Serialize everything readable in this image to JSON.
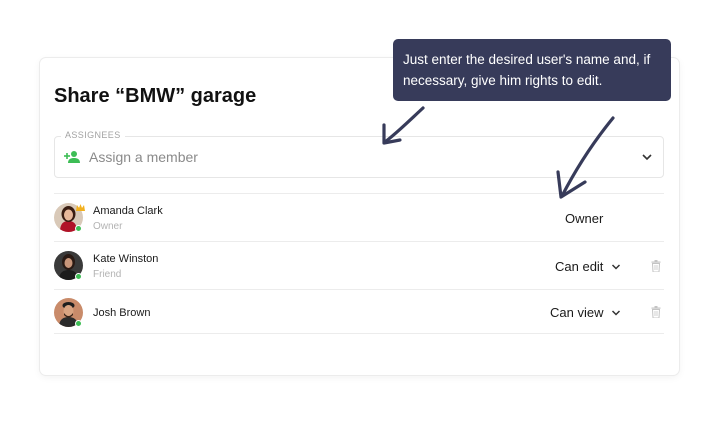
{
  "dialog": {
    "title": "Share “BMW” garage"
  },
  "assign": {
    "legend": "ASSIGNEES",
    "placeholder": "Assign a member",
    "icon": "add-user-icon",
    "accent_color": "#3dbd55"
  },
  "members": [
    {
      "name": "Amanda Clark",
      "role": "Owner",
      "permission": "Owner",
      "editable": false,
      "online": true,
      "badge": "crown-icon"
    },
    {
      "name": "Kate Winston",
      "role": "Friend",
      "permission": "Can edit",
      "editable": true,
      "online": true
    },
    {
      "name": "Josh Brown",
      "role": "",
      "permission": "Can view",
      "editable": true,
      "online": true
    }
  ],
  "tooltip": {
    "text": "Just enter the desired user's name and, if necessary, give him rights to edit.",
    "background": "#373b5a"
  },
  "colors": {
    "online": "#3dbd55",
    "annotation_arrow": "#373b5a"
  }
}
